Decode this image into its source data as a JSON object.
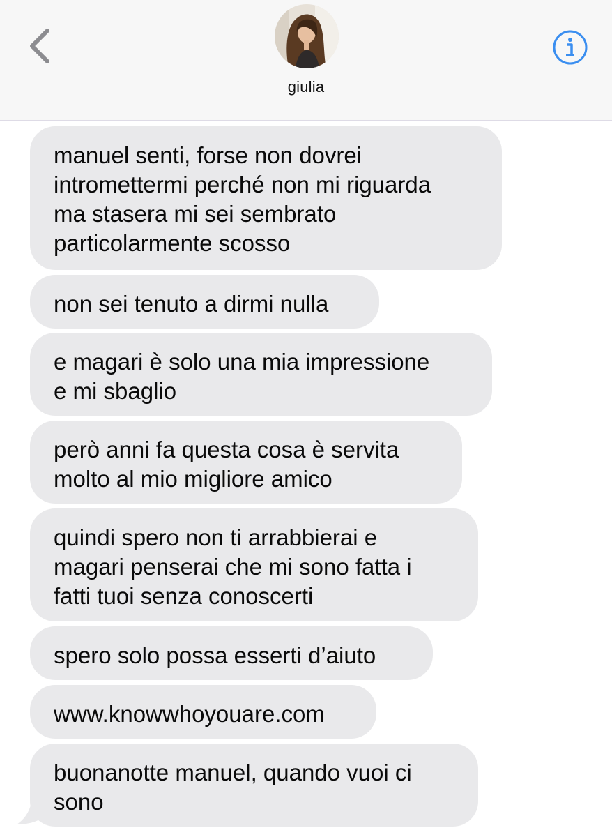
{
  "header": {
    "contact_name": "giulia",
    "back_icon": "chevron-left-icon",
    "info_icon": "info-icon",
    "accent_color": "#3a8ef0"
  },
  "messages": [
    {
      "text": "manuel senti, forse non dovrei\nintromettermi perché non mi riguarda\nma stasera mi sei sembrato\nparticolarmente scosso"
    },
    {
      "text": "non sei tenuto a dirmi nulla"
    },
    {
      "text": "e magari è solo una mia impressione\ne mi sbaglio"
    },
    {
      "text": "però anni fa questa cosa è servita\nmolto al mio migliore amico"
    },
    {
      "text": "quindi spero non ti arrabbierai e\nmagari penserai che mi sono fatta i\nfatti tuoi senza conoscerti"
    },
    {
      "text": "spero solo possa esserti d’aiuto"
    },
    {
      "text": "www.knowwhoyouare.com"
    },
    {
      "text": "buonanotte manuel, quando vuoi ci\nsono"
    }
  ],
  "bubble_color": "#e9e9eb",
  "header_bg": "#f7f7f7"
}
